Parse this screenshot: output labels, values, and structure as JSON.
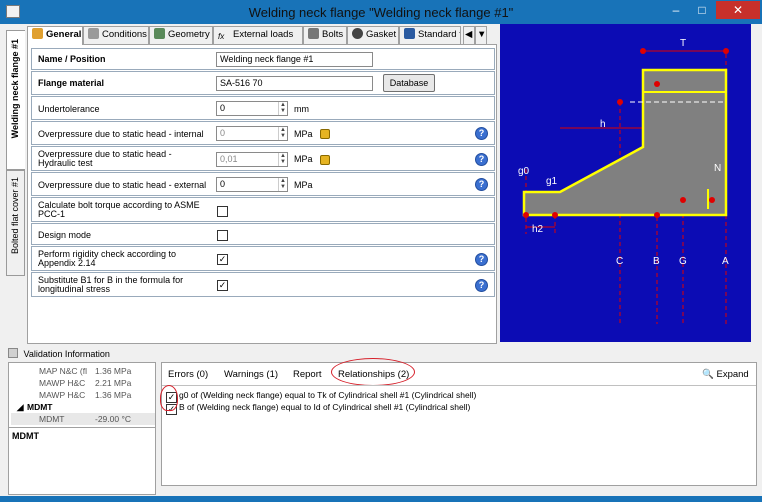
{
  "window": {
    "title": "Welding neck flange \"Welding neck flange #1\"",
    "minimize": "–",
    "maximize": "□",
    "close": "✕"
  },
  "side_tabs": [
    "Welding neck flange #1",
    "Bolted flat cover #1"
  ],
  "tabs": [
    {
      "label": "General",
      "icon": "gear-icon",
      "color": "#e0a030"
    },
    {
      "label": "Conditions",
      "icon": "table-icon",
      "color": "#7a7a7a"
    },
    {
      "label": "Geometry",
      "icon": "geometry-icon",
      "color": "#5a8a5a"
    },
    {
      "label": "External loads",
      "icon": "fx-icon",
      "color": "#333333"
    },
    {
      "label": "Bolts",
      "icon": "bolt-icon",
      "color": "#777777"
    },
    {
      "label": "Gasket",
      "icon": "gasket-icon",
      "color": "#444444"
    },
    {
      "label": "Standard f",
      "icon": "book-icon",
      "color": "#2a5aa0"
    }
  ],
  "form": {
    "name_label": "Name / Position",
    "name_value": "Welding neck flange #1",
    "material_label": "Flange material",
    "material_value": "SA-516 70",
    "database_button": "Database",
    "undertolerance_label": "Undertolerance",
    "undertolerance_value": "0",
    "undertolerance_unit": "mm",
    "op_internal_label": "Overpressure due to static head - internal",
    "op_internal_value": "0",
    "op_internal_unit": "MPa",
    "op_hydro_label": "Overpressure due to static head - Hydraulic test",
    "op_hydro_value": "0,01",
    "op_hydro_unit": "MPa",
    "op_external_label": "Overpressure due to static head - external",
    "op_external_value": "0",
    "op_external_unit": "MPa",
    "bolt_torque_label": "Calculate bolt torque according to ASME PCC-1",
    "design_mode_label": "Design mode",
    "rigidity_label": "Perform rigidity check according to Appendix 2.14",
    "substitute_label": "Substitute B1 for B in the formula for longitudinal stress",
    "help": "?"
  },
  "diagram_labels": {
    "T": "T",
    "h": "h",
    "g0": "g0",
    "g1": "g1",
    "N": "N",
    "h2": "h2",
    "C": "C",
    "B": "B",
    "G": "G",
    "A": "A"
  },
  "validation": {
    "header": "Validation Information",
    "props": [
      {
        "k": "MAP N&C (fl",
        "v": "1.36 MPa"
      },
      {
        "k": "MAWP H&C",
        "v": "2.21 MPa"
      },
      {
        "k": "MAWP H&C",
        "v": "1.36 MPa"
      }
    ],
    "group": "MDMT",
    "group_item": {
      "k": "MDMT",
      "v": "-29.00 °C"
    },
    "desc_title": "MDMT",
    "tabs": [
      "Errors (0)",
      "Warnings (1)",
      "Report",
      "Relationships (2)"
    ],
    "expand": "Expand",
    "relationships": [
      "g0 of  (Welding neck flange) equal to Tk of Cylindrical shell #1 (Cylindrical shell)",
      "B of  (Welding neck flange) equal to Id of Cylindrical shell #1 (Cylindrical shell)"
    ]
  },
  "colors": {
    "diagram_bg": "#0c0cb4",
    "flange_fill": "#808080",
    "outline": "#ffff00",
    "marker": "#e00000",
    "annotation": "#d6202a"
  }
}
